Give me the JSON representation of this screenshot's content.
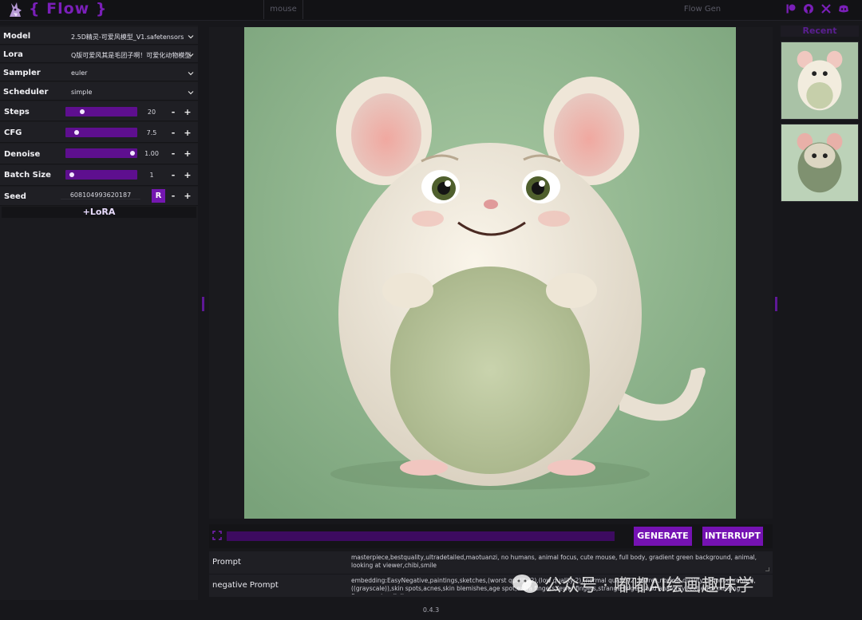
{
  "app": {
    "brand": "{ Flow }",
    "tabs": [
      "mouse",
      "Flow Gen"
    ],
    "version": "0.4.3"
  },
  "header_icons": [
    "patreon-icon",
    "github-icon",
    "x-icon",
    "discord-icon"
  ],
  "settings": {
    "model": {
      "label": "Model",
      "value": "2.5D精灵-可爱风模型_V1.safetensors"
    },
    "lora": {
      "label": "Lora",
      "value": "Q版可爱风其是毛团子啊！可爱化动物模型"
    },
    "sampler": {
      "label": "Sampler",
      "value": "euler"
    },
    "scheduler": {
      "label": "Scheduler",
      "value": "simple"
    },
    "steps": {
      "label": "Steps",
      "value": "20",
      "fraction": 0.22
    },
    "cfg": {
      "label": "CFG",
      "value": "7.5",
      "fraction": 0.13
    },
    "denoise": {
      "label": "Denoise",
      "value": "1.00",
      "fraction": 0.96
    },
    "batch_size": {
      "label": "Batch Size",
      "value": "1",
      "fraction": 0.06
    },
    "seed": {
      "label": "Seed",
      "value": "608104993620187",
      "random_label": "R"
    },
    "plus": "+",
    "minus": "-",
    "add_lora": "+LoRA"
  },
  "actions": {
    "generate": "GENERATE",
    "interrupt": "INTERRUPT",
    "progress": 0.0
  },
  "prompt": {
    "label": "Prompt",
    "text": "masterpiece,bestquality,ultradetailed,maotuanzi, no humans, animal focus, cute mouse, full body, gradient green background, animal, looking at viewer,chibi,smile"
  },
  "negative_prompt": {
    "label": "negative Prompt",
    "text": "embedding:EasyNegative,paintings,sketches,(worst quality:2),(low quality:2),(normal quality:2),lowres,normal quality,((monochrome)),((grayscale)),skin spots,acnes,skin blemishes,age spot,extra fingers,fewer fingers,strange fingers,bad anatomy,text,error,missing fingers,extra digit"
  },
  "recent": {
    "title": "Recent"
  },
  "watermark": {
    "text": "公众号 · 嘟嘟AI绘画趣味学"
  },
  "colors": {
    "accent": "#7512b3",
    "slider": "#5e0f8f",
    "background": "#17171b",
    "image_bg": "#8fb590"
  }
}
